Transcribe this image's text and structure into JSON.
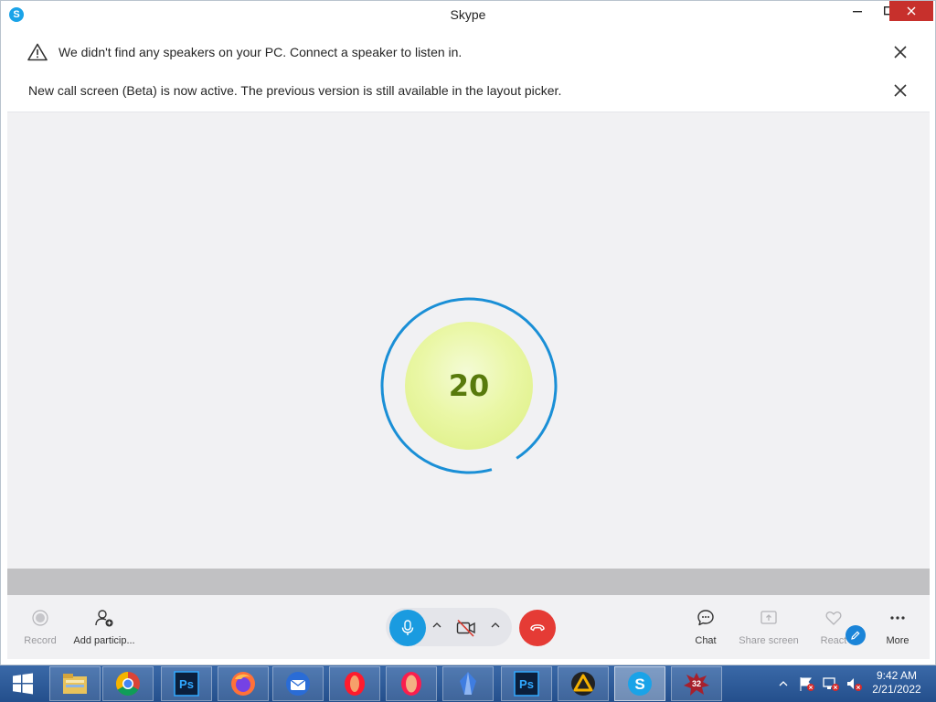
{
  "window": {
    "title": "Skype",
    "app_icon_letter": "S",
    "minimize_icon": "minimize-icon",
    "maximize_icon": "maximize-icon",
    "close_icon": "close-icon"
  },
  "notices": [
    {
      "icon": "warning-icon",
      "text": "We didn't find any speakers on your PC. Connect a speaker to listen in."
    },
    {
      "icon": null,
      "text": "New call screen (Beta) is now active. The previous version is still available in the layout picker."
    }
  ],
  "call": {
    "participant_avatar_text": "20",
    "avatar_color": "#e6f59c",
    "ring_color": "#1a8fd6"
  },
  "controls": {
    "record_label": "Record",
    "add_participant_label": "Add particip...",
    "chat_label": "Chat",
    "share_screen_label": "Share screen",
    "react_label": "React",
    "more_label": "More",
    "mic_on": true,
    "camera_off": true
  },
  "colors": {
    "mic_button": "#1a9be0",
    "end_call_button": "#e53b35",
    "close_button": "#c7302c"
  },
  "taskbar": {
    "items": [
      {
        "name": "start-button",
        "icon": "windows-logo-icon"
      },
      {
        "name": "file-explorer",
        "icon": "folder-icon"
      },
      {
        "name": "chrome",
        "icon": "chrome-icon"
      },
      {
        "name": "photoshop-1",
        "icon": "photoshop-icon",
        "text": "Ps"
      },
      {
        "name": "firefox",
        "icon": "firefox-icon"
      },
      {
        "name": "thunderbird",
        "icon": "thunderbird-icon"
      },
      {
        "name": "opera",
        "icon": "opera-icon"
      },
      {
        "name": "opera-gx",
        "icon": "opera-gx-icon"
      },
      {
        "name": "unknown-app",
        "icon": "crystal-icon"
      },
      {
        "name": "photoshop-2",
        "icon": "photoshop-icon",
        "text": "Ps"
      },
      {
        "name": "aimp",
        "icon": "aimp-icon"
      },
      {
        "name": "skype",
        "icon": "skype-icon",
        "text": "S"
      },
      {
        "name": "splash-app",
        "icon": "splash-icon",
        "text": "32"
      }
    ],
    "clock_time": "9:42 AM",
    "clock_date": "2/21/2022"
  }
}
